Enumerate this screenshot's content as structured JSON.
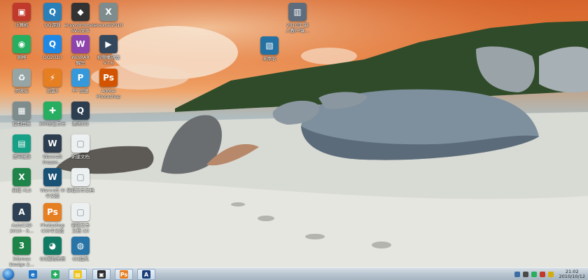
{
  "desktop": {
    "icons": [
      {
        "label": "计算机",
        "glyph": "▣",
        "color": "#c0392b"
      },
      {
        "label": "QQ游戏",
        "glyph": "Q",
        "color": "#2980b9"
      },
      {
        "label": "ecsyndromes-…\nSVG文件",
        "glyph": "◆",
        "color": "#333333"
      },
      {
        "label": "ecexcel2010",
        "glyph": "X",
        "color": "#7f8c8d"
      },
      {
        "label": "网络",
        "glyph": "◉",
        "color": "#27ae60"
      },
      {
        "label": "QQ2010",
        "glyph": "Q",
        "color": "#1e88e5"
      },
      {
        "label": "WinRAR\n解压",
        "glyph": "W",
        "color": "#8e44ad"
      },
      {
        "label": "视频播放器\nV7.6",
        "glyph": "▶",
        "color": "#34495e"
      },
      {
        "label": "回收站",
        "glyph": "♻",
        "color": "#95a5a6"
      },
      {
        "label": "迅雷5",
        "glyph": "⚡",
        "color": "#e67e22"
      },
      {
        "label": "PP 加速",
        "glyph": "P",
        "color": "#3498db"
      },
      {
        "label": "Adobe\nPhotoshop",
        "glyph": "Ps",
        "color": "#d35400"
      },
      {
        "label": "控制面板",
        "glyph": "▦",
        "color": "#7f8c8d"
      },
      {
        "label": "360安全卫士",
        "glyph": "✚",
        "color": "#27ae60"
      },
      {
        "label": "腾讯QQ",
        "glyph": "Q",
        "color": "#2c3e50"
      },
      {
        "label": "宽带连接",
        "glyph": "▤",
        "color": "#16a085"
      },
      {
        "label": "Warcraft\nFrozen…",
        "glyph": "W",
        "color": "#2c3e50"
      },
      {
        "label": "新建文档",
        "glyph": "▢",
        "color": "#ecf0f1"
      },
      {
        "label": "新建 XLS",
        "glyph": "X",
        "color": "#1e8449"
      },
      {
        "label": "Warcraft III\n中文版",
        "glyph": "W",
        "color": "#1a5276"
      },
      {
        "label": "新建文本文档",
        "glyph": "▢",
        "color": "#ecf0f1"
      },
      {
        "label": "AutoCAD\n2010 - S…",
        "glyph": "A",
        "color": "#2e4053"
      },
      {
        "label": "Photoshop\nCS5中文版",
        "glyph": "Ps",
        "color": "#e67e22"
      },
      {
        "label": "新建文本\n文档 (2)",
        "glyph": "▢",
        "color": "#ecf0f1"
      },
      {
        "label": "3dsmax\nDesign 2…",
        "glyph": "3",
        "color": "#1d8348"
      },
      {
        "label": "QQ宠物乐园",
        "glyph": "◕",
        "color": "#117a65"
      },
      {
        "label": "QQ旋风",
        "glyph": "◍",
        "color": "#2874a6"
      },
      {
        "label": "2010年 新\n人教PP课…",
        "glyph": "▥",
        "color": "#5d6d7e"
      },
      {
        "label": "未命名",
        "glyph": "▧",
        "color": "#2471a3"
      }
    ]
  },
  "taskbar": {
    "start_label": "Start",
    "pinned": [
      {
        "name": "ie",
        "glyph": "e",
        "color": "#1f77c9"
      },
      {
        "name": "360",
        "glyph": "✚",
        "color": "#27ae60"
      },
      {
        "name": "explorer",
        "glyph": "▤",
        "color": "#f0c419"
      },
      {
        "name": "media",
        "glyph": "▣",
        "color": "#2b2b2b"
      },
      {
        "name": "photoshop",
        "glyph": "Ps",
        "color": "#e67e22"
      },
      {
        "name": "autocad",
        "glyph": "A",
        "color": "#1a3d7a"
      }
    ],
    "clock_time": "21:02",
    "clock_date": "2010/10/12"
  }
}
